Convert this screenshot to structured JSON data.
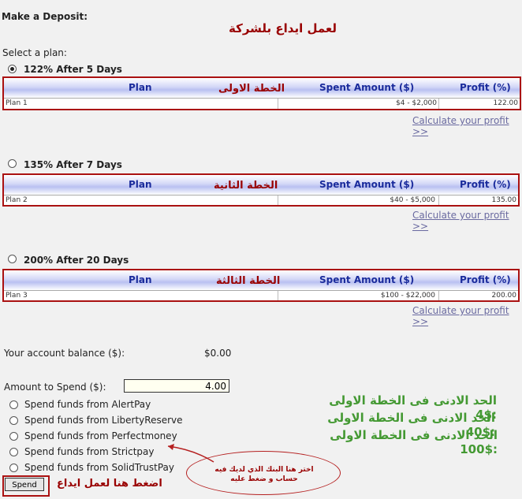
{
  "page": {
    "title": "Make a Deposit:",
    "arabic_title": "لعمل ايداع بلشركة",
    "select_plan_label": "Select a plan:"
  },
  "table_headers": {
    "plan": "Plan",
    "spent": "Spent Amount ($)",
    "profit": "Profit (%)"
  },
  "plans": [
    {
      "option_label": "122% After 5 Days",
      "checked": true,
      "arabic_label": "الخطة الاولى",
      "name": "Plan 1",
      "range": "$4 - $2,000",
      "profit": "122.00"
    },
    {
      "option_label": "135% After 7 Days",
      "checked": false,
      "arabic_label": "الخطة الثانية",
      "name": "Plan 2",
      "range": "$40 - $5,000",
      "profit": "135.00"
    },
    {
      "option_label": "200% After 20 Days",
      "checked": false,
      "arabic_label": "الخطة الثالثة",
      "name": "Plan 3",
      "range": "$100 - $22,000",
      "profit": "200.00"
    }
  ],
  "calculate_link": "Calculate your profit >>",
  "balance": {
    "label": "Your account balance ($):",
    "value": "$0.00"
  },
  "amount": {
    "label": "Amount to Spend ($):",
    "value": "4.00"
  },
  "funding_options": [
    "Spend funds from AlertPay",
    "Spend funds from LibertyReserve",
    "Spend funds from Perfectmoney",
    "Spend funds from Strictpay",
    "Spend funds from SolidTrustPay"
  ],
  "minimums": [
    "الحد الادنى فى الخطة الاولى :$4",
    "الحد الادنى فى الخطة الاولى :$40",
    "الحد الادنى فى الخطة الاولى :$100"
  ],
  "ellipse_note": "اختر هنا البنك الذي لديك فيه حساب و ضغط عليه",
  "spend_button": "Spend",
  "spend_note": "اضغط هنا لعمل ايداع",
  "colors": {
    "annotation_red": "#990000",
    "annotation_green": "#449933",
    "header_blue": "#1a2b9c"
  }
}
